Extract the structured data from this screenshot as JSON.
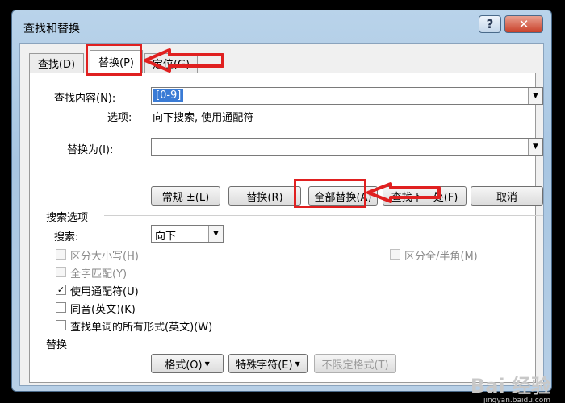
{
  "window": {
    "title": "查找和替换",
    "help": "?",
    "close": "✕"
  },
  "tabs": [
    {
      "label": "查找(D)"
    },
    {
      "label": "替换(P)"
    },
    {
      "label": "定位(G)"
    }
  ],
  "find": {
    "label": "查找内容(N):",
    "value": "[0-9]",
    "options_label": "选项:",
    "options_value": "向下搜索, 使用通配符"
  },
  "replace": {
    "label": "替换为(I):",
    "value": ""
  },
  "buttons": {
    "more": "常规 ±(L)",
    "replace": "替换(R)",
    "replace_all": "全部替换(A)",
    "find_next": "查找下一处(F)",
    "cancel": "取消"
  },
  "search_options": {
    "header": "搜索选项",
    "direction_label": "搜索:",
    "direction_value": "向下",
    "checks": [
      {
        "label": "区分大小写(H)",
        "checked": false,
        "enabled": false
      },
      {
        "label": "全字匹配(Y)",
        "checked": false,
        "enabled": false
      },
      {
        "label": "使用通配符(U)",
        "checked": true,
        "enabled": true
      },
      {
        "label": "同音(英文)(K)",
        "checked": false,
        "enabled": true
      },
      {
        "label": "查找单词的所有形式(英文)(W)",
        "checked": false,
        "enabled": true
      }
    ],
    "right_check": {
      "label": "区分全/半角(M)",
      "checked": false,
      "enabled": false
    }
  },
  "replace_section": {
    "header": "替换",
    "format": "格式(O)",
    "special": "特殊字符(E)",
    "no_format": "不限定格式(T)"
  },
  "watermark": {
    "main": "Bai 经验",
    "sub": "jingyan.baidu.com"
  },
  "colors": {
    "highlight": "#e02020",
    "selection": "#3a7bd5"
  }
}
